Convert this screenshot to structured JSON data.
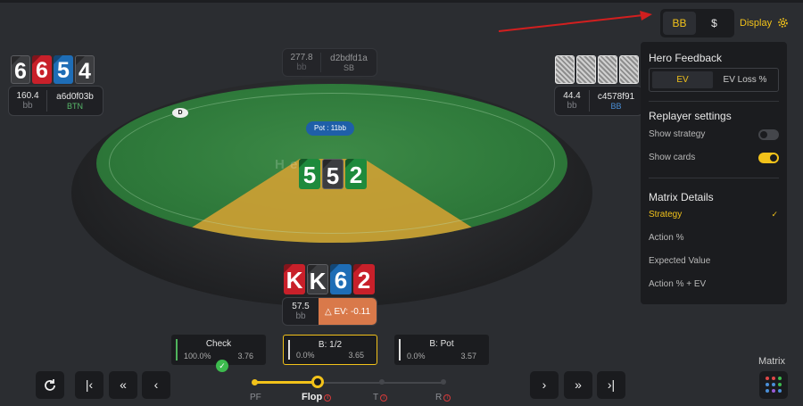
{
  "table": {
    "pot_label": "Pot : 11bb",
    "watermark": "H   ero",
    "dealer_button": "D",
    "board": [
      {
        "rank": "5",
        "suit": "club"
      },
      {
        "rank": "5",
        "suit": "spade"
      },
      {
        "rank": "2",
        "suit": "club"
      }
    ]
  },
  "players": {
    "btn": {
      "stack": "160.4",
      "unit": "bb",
      "name": "a6d0f03b",
      "position": "BTN",
      "cards": [
        {
          "rank": "6",
          "suit": "spade"
        },
        {
          "rank": "6",
          "suit": "heart"
        },
        {
          "rank": "5",
          "suit": "diamond"
        },
        {
          "rank": "4",
          "suit": "spade"
        }
      ]
    },
    "sb": {
      "stack": "277.8",
      "unit": "bb",
      "name": "d2bdfd1a",
      "position": "SB"
    },
    "bb": {
      "stack": "44.4",
      "unit": "bb",
      "name": "c4578f91",
      "position": "BB"
    },
    "hero": {
      "stack": "57.5",
      "unit": "bb",
      "ev_label": "△ EV: -0.11",
      "cards": [
        {
          "rank": "K",
          "suit": "heart"
        },
        {
          "rank": "K",
          "suit": "spade"
        },
        {
          "rank": "6",
          "suit": "diamond"
        },
        {
          "rank": "2",
          "suit": "heart"
        }
      ]
    }
  },
  "actions": [
    {
      "label": "Check",
      "freq": "100.0%",
      "ev": "3.76"
    },
    {
      "label": "B: 1/2",
      "freq": "0.0%",
      "ev": "3.65"
    },
    {
      "label": "B: Pot",
      "freq": "0.0%",
      "ev": "3.57"
    }
  ],
  "streets": {
    "pf": "PF",
    "flop": "Flop",
    "turn": "T",
    "river": "R",
    "info": "i"
  },
  "controls": {
    "matrix_label": "Matrix",
    "display_label": "Display"
  },
  "units": {
    "bb": "BB",
    "dollar": "$"
  },
  "panel": {
    "hero_feedback": "Hero Feedback",
    "tab_ev": "EV",
    "tab_ev_loss": "EV Loss %",
    "replayer_settings": "Replayer settings",
    "show_strategy": "Show strategy",
    "show_cards": "Show cards",
    "show_strategy_on": false,
    "show_cards_on": true,
    "matrix_details": "Matrix Details",
    "strategy": "Strategy",
    "check": "✓",
    "action_pct": "Action %",
    "expected_value": "Expected Value",
    "action_pct_ev": "Action % + EV"
  },
  "colors": {
    "accent": "#f2c21a",
    "heart": "#c8202a",
    "diamond": "#1e6db6",
    "club": "#1e8a3c",
    "spade": "#3c3d40",
    "ev_negative": "#d9794a"
  }
}
